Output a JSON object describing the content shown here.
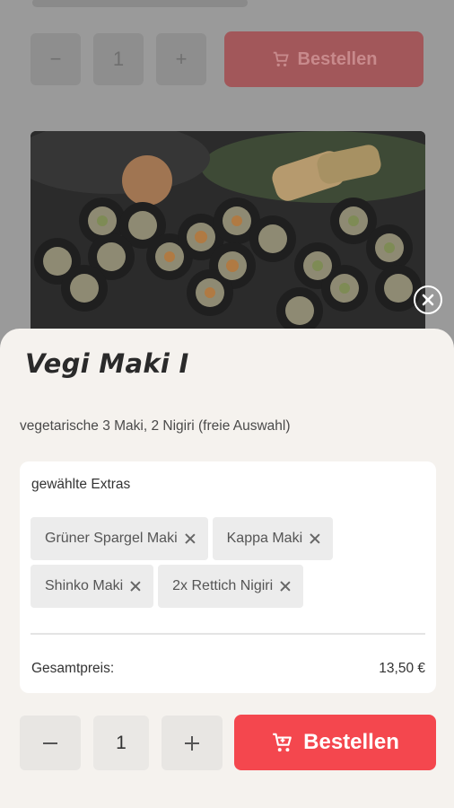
{
  "background": {
    "quantity_value": "1",
    "order_label": "Bestellen",
    "minus_symbol": "−",
    "plus_symbol": "+"
  },
  "dialog": {
    "title": "Vegi Maki I",
    "description": "vegetarische 3 Maki, 2 Nigiri (freie Auswahl)",
    "extras": {
      "heading": "gewählte Extras",
      "items": [
        {
          "label": "Grüner Spargel Maki"
        },
        {
          "label": "Kappa Maki"
        },
        {
          "label": "Shinko Maki"
        },
        {
          "label": "2x Rettich Nigiri"
        }
      ]
    },
    "total": {
      "label": "Gesamtpreis:",
      "value": "13,50 €"
    },
    "quantity": {
      "minus_symbol": "−",
      "value": "1",
      "plus_symbol": "+"
    },
    "order_button": {
      "label": "Bestellen",
      "icon": "cart-icon"
    }
  },
  "colors": {
    "accent": "#f4474e",
    "sheet_background": "#f5f2ee",
    "chip_background": "#ececec"
  }
}
